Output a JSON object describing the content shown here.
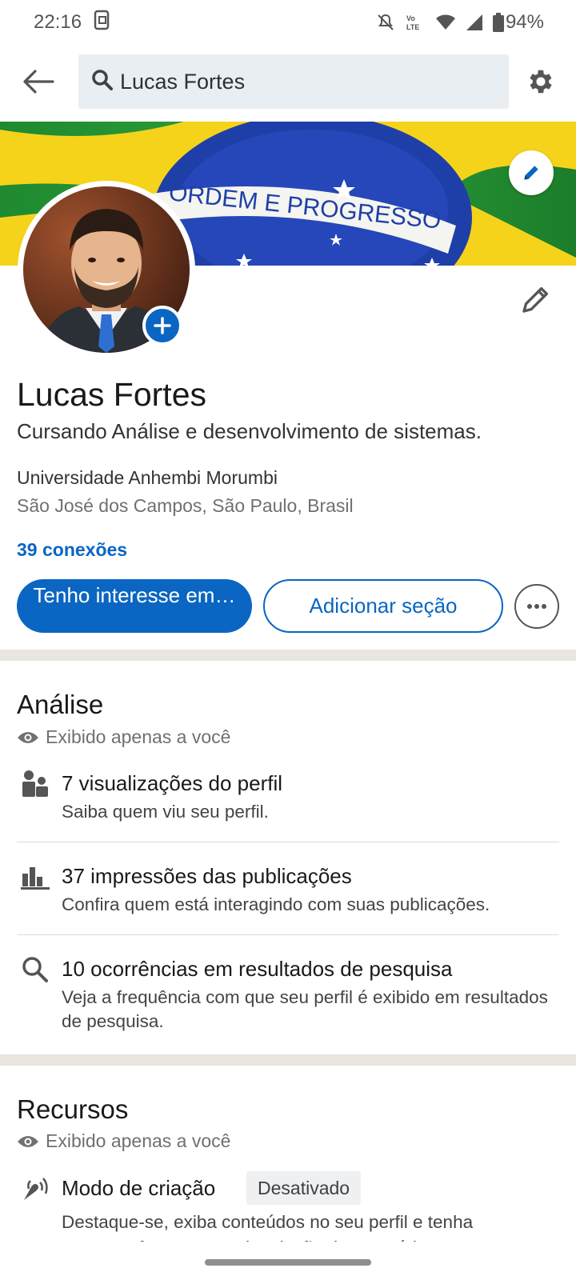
{
  "status_bar": {
    "time": "22:16",
    "battery": "94%"
  },
  "top_bar": {
    "search_value": "Lucas Fortes"
  },
  "banner": {
    "motto": "ORDEM E PROGRESSO"
  },
  "profile": {
    "name": "Lucas Fortes",
    "headline": "Cursando Análise e desenvolvimento de sistemas.",
    "school": "Universidade Anhembi Morumbi",
    "location": "São José dos Campos, São Paulo, Brasil",
    "connections": "39 conexões"
  },
  "actions": {
    "primary_label": "Tenho interesse em…",
    "secondary_label": "Adicionar seção"
  },
  "analysis": {
    "title": "Análise",
    "visibility": "Exibido apenas a você",
    "items": [
      {
        "title": "7 visualizações do perfil",
        "desc": "Saiba quem viu seu perfil."
      },
      {
        "title": "37 impressões das publicações",
        "desc": "Confira quem está interagindo com suas publicações."
      },
      {
        "title": "10 ocorrências em resultados de pesquisa",
        "desc": "Veja a frequência com que seu perfil é exibido em resultados de pesquisa."
      }
    ]
  },
  "resources": {
    "title": "Recursos",
    "visibility": "Exibido apenas a você",
    "creator_title": "Modo de criação",
    "creator_badge": "Desativado",
    "creator_desc_line1": "Destaque-se, exiba conteúdos no seu perfil e tenha",
    "creator_desc_line2": "acesso a ferramentas de criação de conteúdo"
  },
  "colors": {
    "accent": "#0a66c2",
    "divider": "#e9e5df"
  }
}
